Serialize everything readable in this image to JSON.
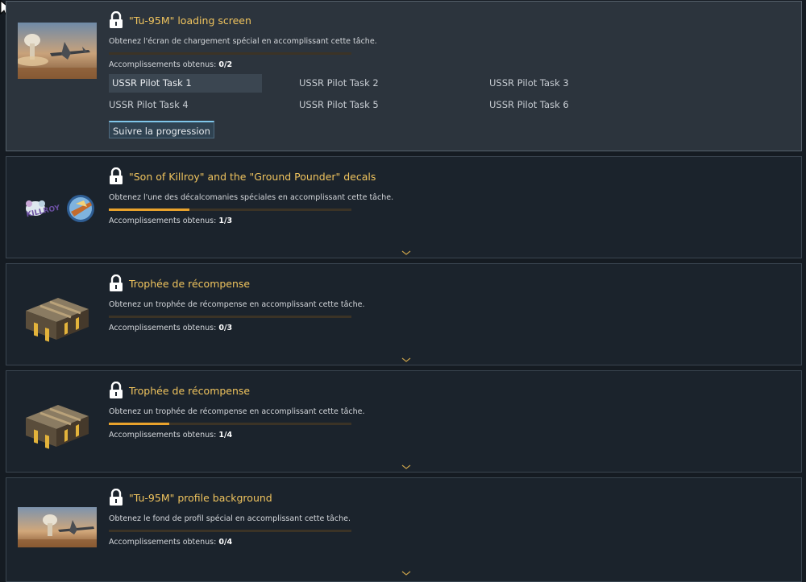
{
  "rewards": [
    {
      "title": "\"Tu-95M\" loading screen",
      "description": "Obtenez l'écran de chargement spécial en accomplissant cette tâche.",
      "count_label": "Accomplissements obtenus:",
      "count_value": "0/2",
      "progress": 0.0,
      "thumbnail": "tu-95m-aircraft-image",
      "tasks": [
        "USSR Pilot Task 1",
        "USSR Pilot Task 2",
        "USSR Pilot Task 3",
        "USSR Pilot Task 4",
        "USSR Pilot Task 5",
        "USSR Pilot Task 6"
      ],
      "action_label": "Suivre la progression"
    },
    {
      "title": "\"Son of Killroy\" and the \"Ground Pounder\" decals",
      "description": "Obtenez l'une des décalcomanies spéciales en accomplissant cette tâche.",
      "count_label": "Accomplissements obtenus:",
      "count_value": "1/3",
      "progress": 0.333,
      "thumbnail": "decals-image"
    },
    {
      "title": "Trophée de récompense",
      "description": "Obtenez un trophée de récompense en accomplissant cette tâche.",
      "count_label": "Accomplissements obtenus:",
      "count_value": "0/3",
      "progress": 0.0,
      "thumbnail": "trophy-chest-image"
    },
    {
      "title": "Trophée de récompense",
      "description": "Obtenez un trophée de récompense en accomplissant cette tâche.",
      "count_label": "Accomplissements obtenus:",
      "count_value": "1/4",
      "progress": 0.25,
      "thumbnail": "trophy-chest-image"
    },
    {
      "title": "\"Tu-95M\" profile background",
      "description": "Obtenez le fond de profil spécial en accomplissant cette tâche.",
      "count_label": "Accomplissements obtenus:",
      "count_value": "0/4",
      "progress": 0.0,
      "thumbnail": "tu-95m-aircraft-image"
    }
  ],
  "colors": {
    "title": "#f0c45e",
    "progress_fill": "#e8a22c",
    "progress_track": "#3b3326",
    "card_bg": "#1b232c",
    "card_bg_expanded": "#2c343d",
    "accent_border": "#7fc6ea"
  },
  "icons": {
    "lock": "lock-icon",
    "expand": "expand-chevron-icon",
    "cursor": "mouse-cursor-icon"
  }
}
